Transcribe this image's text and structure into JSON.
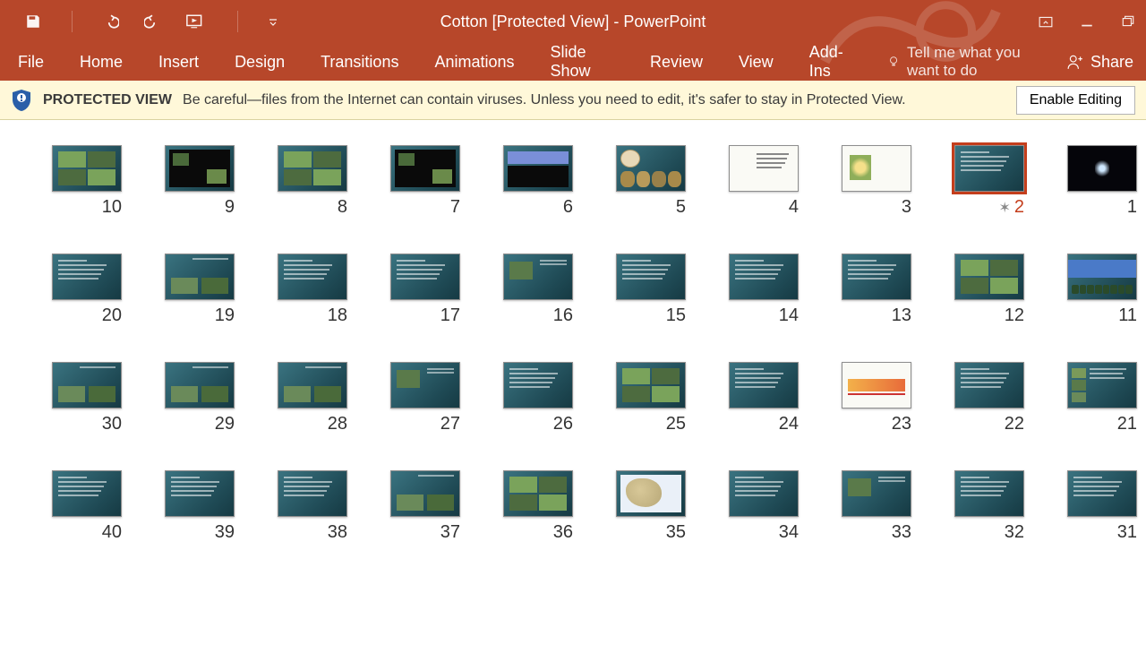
{
  "titlebar": {
    "title": "Cotton [Protected View] - PowerPoint"
  },
  "ribbon": {
    "tabs": [
      "File",
      "Home",
      "Insert",
      "Design",
      "Transitions",
      "Animations",
      "Slide Show",
      "Review",
      "View",
      "Add-Ins"
    ],
    "tellme": "Tell me what you want to do",
    "share": "Share"
  },
  "protected_view": {
    "title": "PROTECTED VIEW",
    "text": "Be careful—files from the Internet can contain viruses. Unless you need to edit, it's safer to stay in Protected View.",
    "enable": "Enable Editing"
  },
  "sorter": {
    "selected": 2,
    "animated": [
      2
    ],
    "slides": [
      {
        "n": 1,
        "style": "dark"
      },
      {
        "n": 2,
        "style": "teal-text"
      },
      {
        "n": 3,
        "style": "light-flower"
      },
      {
        "n": 4,
        "style": "light-text"
      },
      {
        "n": 5,
        "style": "seeds"
      },
      {
        "n": 6,
        "style": "diagram"
      },
      {
        "n": 7,
        "style": "dark-pics"
      },
      {
        "n": 8,
        "style": "green-pics"
      },
      {
        "n": 9,
        "style": "dark-pics"
      },
      {
        "n": 10,
        "style": "green-pics"
      },
      {
        "n": 11,
        "style": "blue-band"
      },
      {
        "n": 12,
        "style": "green-pics"
      },
      {
        "n": 13,
        "style": "teal-text"
      },
      {
        "n": 14,
        "style": "teal-text"
      },
      {
        "n": 15,
        "style": "teal-text"
      },
      {
        "n": 16,
        "style": "one-pic"
      },
      {
        "n": 17,
        "style": "teal-text"
      },
      {
        "n": 18,
        "style": "teal-text"
      },
      {
        "n": 19,
        "style": "two-pic"
      },
      {
        "n": 20,
        "style": "teal-text"
      },
      {
        "n": 21,
        "style": "side-pics"
      },
      {
        "n": 22,
        "style": "teal-text"
      },
      {
        "n": 23,
        "style": "light-table"
      },
      {
        "n": 24,
        "style": "teal-text"
      },
      {
        "n": 25,
        "style": "green-pics"
      },
      {
        "n": 26,
        "style": "teal-text"
      },
      {
        "n": 27,
        "style": "one-pic"
      },
      {
        "n": 28,
        "style": "two-pic"
      },
      {
        "n": 29,
        "style": "two-pic"
      },
      {
        "n": 30,
        "style": "two-pic"
      },
      {
        "n": 31,
        "style": "teal-text"
      },
      {
        "n": 32,
        "style": "teal-text"
      },
      {
        "n": 33,
        "style": "one-pic"
      },
      {
        "n": 34,
        "style": "teal-text"
      },
      {
        "n": 35,
        "style": "map"
      },
      {
        "n": 36,
        "style": "green-pics"
      },
      {
        "n": 37,
        "style": "two-pic"
      },
      {
        "n": 38,
        "style": "teal-text"
      },
      {
        "n": 39,
        "style": "teal-text"
      },
      {
        "n": 40,
        "style": "teal-text"
      }
    ]
  },
  "icons": {
    "save": "save-icon",
    "undo": "undo-icon",
    "redo": "redo-icon",
    "present": "present-from-beginning-icon",
    "qat_more": "customize-qat-icon",
    "ribbon_opts": "ribbon-display-options-icon",
    "min": "minimize-icon",
    "max": "restore-icon",
    "close": "close-icon"
  }
}
